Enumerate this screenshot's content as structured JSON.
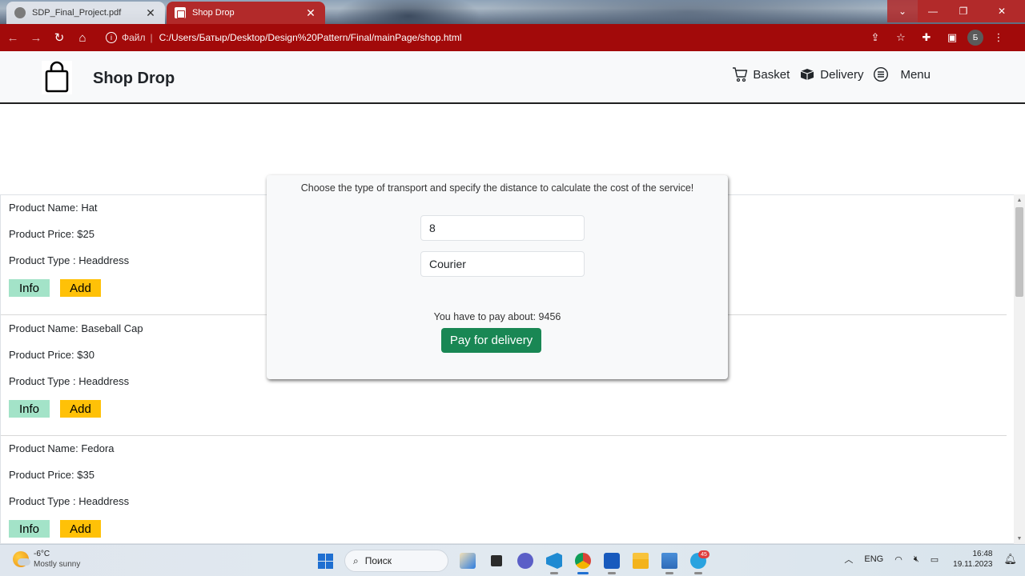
{
  "browser": {
    "tabs": [
      {
        "title": "SDP_Final_Project.pdf",
        "close": "✕"
      },
      {
        "title": "Shop Drop",
        "close": "✕"
      }
    ],
    "window_controls": {
      "caret": "⌄",
      "minimize": "—",
      "maximize": "❐",
      "close": "✕"
    },
    "nav": {
      "back": "←",
      "forward": "→",
      "reload": "↻",
      "home": "⌂"
    },
    "address": {
      "info_glyph": "i",
      "scheme_label": "Файл",
      "separator": "|",
      "url": "C:/Users/Батыр/Desktop/Design%20Pattern/Final/mainPage/shop.html"
    },
    "toolbar_icons": {
      "share": "⇪",
      "star": "☆",
      "extensions": "✚",
      "sidebar": "▣",
      "kebab": "⋮"
    },
    "profile_initial": "Б"
  },
  "site": {
    "brand": "Shop Drop",
    "nav": {
      "basket": "Basket",
      "delivery": "Delivery",
      "menu": "Menu"
    }
  },
  "products": [
    {
      "name_line": "Product Name: Hat",
      "price_line": "Product Price: $25",
      "type_line": "Product Type : Headdress",
      "info": "Info",
      "add": "Add"
    },
    {
      "name_line": "Product Name: Baseball Cap",
      "price_line": "Product Price: $30",
      "type_line": "Product Type : Headdress",
      "info": "Info",
      "add": "Add"
    },
    {
      "name_line": "Product Name: Fedora",
      "price_line": "Product Price: $35",
      "type_line": "Product Type : Headdress",
      "info": "Info",
      "add": "Add"
    }
  ],
  "scrollbar": {
    "up": "▲",
    "down": "▼"
  },
  "modal": {
    "prompt": "Choose the type of transport and specify the distance to calculate the cost of the service!",
    "distance_value": "8",
    "transport_value": "Courier",
    "result": "You have to pay about: 9456",
    "pay_button": "Pay for delivery"
  },
  "taskbar": {
    "weather": {
      "temp": "-6°C",
      "condition": "Mostly sunny"
    },
    "search_label": "Поиск",
    "search_glyph": "⌕",
    "telegram_badge": "45",
    "tray": {
      "chevron": "︿",
      "lang": "ENG",
      "wifi": "◠",
      "volume": "🔇︎",
      "battery": "▭",
      "time": "16:48",
      "date": "19.11.2023",
      "notif": "🔔︎"
    }
  },
  "colors": {
    "browser_frame": "#a20a0a",
    "active_tab": "#b22a2a",
    "info_button": "#a3e3c8",
    "add_button": "#ffc107",
    "pay_button": "#198754"
  }
}
